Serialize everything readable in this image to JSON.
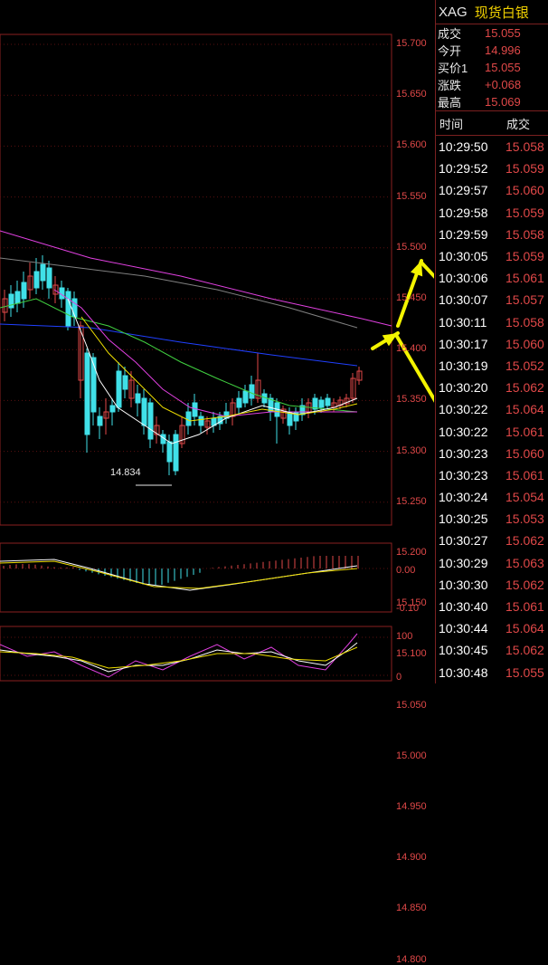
{
  "header": {
    "symbol": "XAG",
    "name": "现货白银"
  },
  "quote": [
    {
      "label": "成交",
      "value": "15.055"
    },
    {
      "label": "今开",
      "value": "14.996"
    },
    {
      "label": "买价1",
      "value": "15.055"
    },
    {
      "label": "涨跌",
      "value": "+0.068"
    },
    {
      "label": "最高",
      "value": "15.069"
    }
  ],
  "trades_header": {
    "time": "时间",
    "price": "成交"
  },
  "trades": [
    {
      "time": "10:29:50",
      "price": "15.058"
    },
    {
      "time": "10:29:52",
      "price": "15.059"
    },
    {
      "time": "10:29:57",
      "price": "15.060"
    },
    {
      "time": "10:29:58",
      "price": "15.059"
    },
    {
      "time": "10:29:59",
      "price": "15.058"
    },
    {
      "time": "10:30:05",
      "price": "15.059"
    },
    {
      "time": "10:30:06",
      "price": "15.061"
    },
    {
      "time": "10:30:07",
      "price": "15.057"
    },
    {
      "time": "10:30:11",
      "price": "15.058"
    },
    {
      "time": "10:30:17",
      "price": "15.060"
    },
    {
      "time": "10:30:19",
      "price": "15.052"
    },
    {
      "time": "10:30:20",
      "price": "15.062"
    },
    {
      "time": "10:30:22",
      "price": "15.064"
    },
    {
      "time": "10:30:22",
      "price": "15.061"
    },
    {
      "time": "10:30:23",
      "price": "15.060"
    },
    {
      "time": "10:30:23",
      "price": "15.061"
    },
    {
      "time": "10:30:24",
      "price": "15.054"
    },
    {
      "time": "10:30:25",
      "price": "15.053"
    },
    {
      "time": "10:30:27",
      "price": "15.062"
    },
    {
      "time": "10:30:29",
      "price": "15.063"
    },
    {
      "time": "10:30:30",
      "price": "15.062"
    },
    {
      "time": "10:30:40",
      "price": "15.061"
    },
    {
      "time": "10:30:44",
      "price": "15.064"
    },
    {
      "time": "10:30:45",
      "price": "15.062"
    },
    {
      "time": "10:30:48",
      "price": "15.055"
    }
  ],
  "chart": {
    "price_axis": [
      "15.700",
      "15.650",
      "15.600",
      "15.550",
      "15.500",
      "15.450",
      "15.400",
      "15.350",
      "15.300",
      "15.250",
      "15.200",
      "15.150",
      "15.100",
      "15.050",
      "15.000",
      "14.950",
      "14.900",
      "14.850",
      "14.800"
    ],
    "low_label": "14.834",
    "macd_axis": [
      "0.00",
      "-0.10"
    ],
    "kdj_axis": [
      "100",
      "0"
    ],
    "colors": {
      "up": "#e04848",
      "down": "#40e0e8",
      "ma1": "#ffffff",
      "ma2": "#f0e000",
      "ma3": "#e040e0",
      "ma4": "#40d040",
      "ma5": "#808080",
      "ma6": "#2040ff"
    }
  }
}
